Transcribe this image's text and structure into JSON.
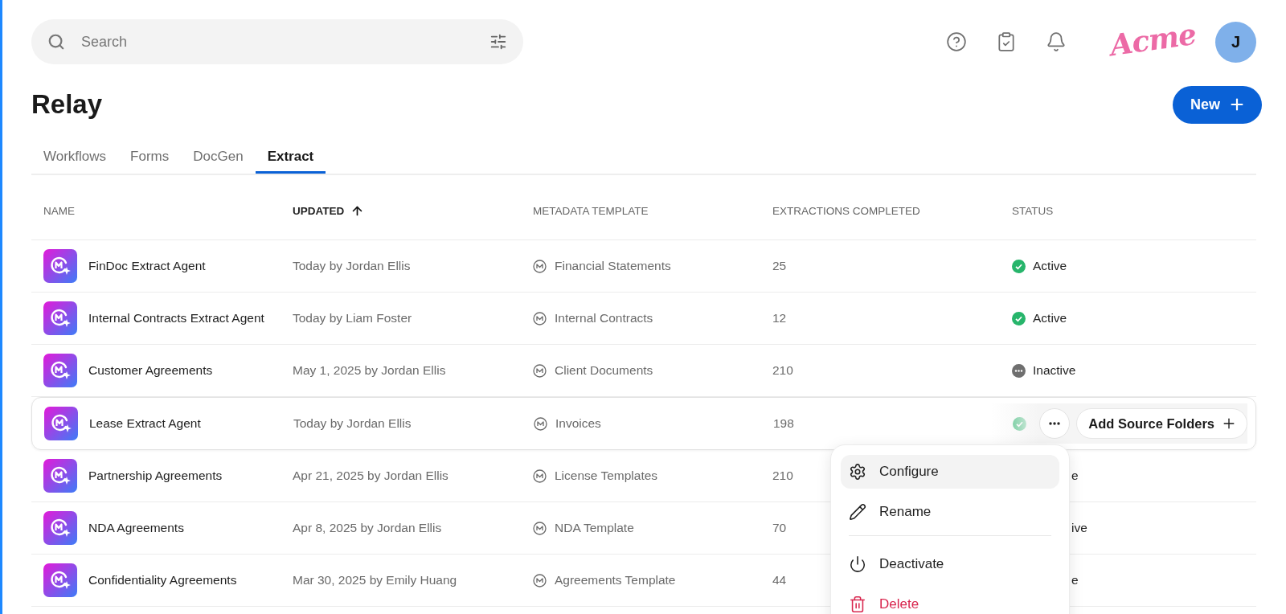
{
  "search": {
    "placeholder": "Search"
  },
  "logo": {
    "text": "Acme"
  },
  "avatar": {
    "initial": "J"
  },
  "page": {
    "title": "Relay",
    "new_button": "New"
  },
  "tabs": [
    {
      "label": "Workflows",
      "selected": false
    },
    {
      "label": "Forms",
      "selected": false
    },
    {
      "label": "DocGen",
      "selected": false
    },
    {
      "label": "Extract",
      "selected": true
    }
  ],
  "table": {
    "columns": [
      {
        "label": "NAME",
        "sorted": false
      },
      {
        "label": "UPDATED",
        "sorted": true
      },
      {
        "label": "METADATA TEMPLATE",
        "sorted": false
      },
      {
        "label": "EXTRACTIONS COMPLETED",
        "sorted": false
      },
      {
        "label": "STATUS",
        "sorted": false
      }
    ],
    "rows": [
      {
        "name": "FinDoc Extract Agent",
        "updated": "Today by Jordan Ellis",
        "template": "Financial Statements",
        "extractions": "25",
        "status": {
          "kind": "active",
          "text": "Active"
        },
        "hovered": false
      },
      {
        "name": "Internal Contracts Extract Agent",
        "updated": "Today by Liam Foster",
        "template": "Internal Contracts",
        "extractions": "12",
        "status": {
          "kind": "active",
          "text": "Active"
        },
        "hovered": false
      },
      {
        "name": "Customer Agreements",
        "updated": "May 1, 2025 by Jordan Ellis",
        "template": "Client Documents",
        "extractions": "210",
        "status": {
          "kind": "inactive",
          "text": "Inactive"
        },
        "hovered": false
      },
      {
        "name": "Lease Extract Agent",
        "updated": "Today by Jordan Ellis",
        "template": "Invoices",
        "extractions": "198",
        "status": {
          "kind": "active"
        },
        "hovered": true
      },
      {
        "name": "Partnership Agreements",
        "updated": "Apr 21, 2025 by Jordan Ellis",
        "template": "License Templates",
        "extractions": "210",
        "status": {
          "kind": "covered",
          "text": "e"
        },
        "hovered": false
      },
      {
        "name": "NDA Agreements",
        "updated": "Apr 8, 2025 by Jordan Ellis",
        "template": "NDA Template",
        "extractions": "70",
        "status": {
          "kind": "covered",
          "text": "ive"
        },
        "hovered": false
      },
      {
        "name": "Confidentiality Agreements",
        "updated": "Mar 30, 2025 by Emily Huang",
        "template": "Agreements Template",
        "extractions": "44",
        "status": {
          "kind": "covered",
          "text": "e"
        },
        "hovered": false
      }
    ]
  },
  "row_actions": {
    "add_button": "Add Source Folders"
  },
  "menu": {
    "items": [
      {
        "label": "Configure",
        "kind": "configure",
        "highlighted": true,
        "danger": false
      },
      {
        "label": "Rename",
        "kind": "rename",
        "highlighted": false,
        "danger": false
      },
      {
        "kind": "divider"
      },
      {
        "label": "Deactivate",
        "kind": "deactivate",
        "highlighted": false,
        "danger": false
      },
      {
        "label": "Delete",
        "kind": "delete",
        "highlighted": false,
        "danger": true
      }
    ]
  }
}
